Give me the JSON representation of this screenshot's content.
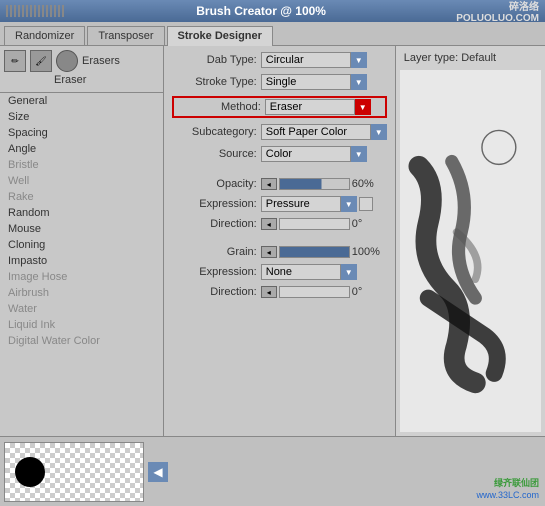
{
  "titleBar": {
    "grip": "grip",
    "title": "Brush Creator @ 100%",
    "logo": "碎洛络\nPOLUOLUO.COM"
  },
  "tabs": [
    {
      "id": "randomizer",
      "label": "Randomizer",
      "active": false
    },
    {
      "id": "transposer",
      "label": "Transposer",
      "active": false
    },
    {
      "id": "stroke-designer",
      "label": "Stroke Designer",
      "active": true
    }
  ],
  "leftPanel": {
    "erasersLabel": "Erasers",
    "eraserLabel": "Eraser",
    "categories": [
      {
        "id": "general",
        "label": "General",
        "active": false
      },
      {
        "id": "size",
        "label": "Size",
        "active": false
      },
      {
        "id": "spacing",
        "label": "Spacing",
        "active": false
      },
      {
        "id": "angle",
        "label": "Angle",
        "active": false
      },
      {
        "id": "bristle",
        "label": "Bristle",
        "active": false,
        "disabled": true
      },
      {
        "id": "well",
        "label": "Well",
        "active": false,
        "disabled": true
      },
      {
        "id": "rake",
        "label": "Rake",
        "active": false,
        "disabled": true
      },
      {
        "id": "random",
        "label": "Random",
        "active": false
      },
      {
        "id": "mouse",
        "label": "Mouse",
        "active": false
      },
      {
        "id": "cloning",
        "label": "Cloning",
        "active": false
      },
      {
        "id": "impasto",
        "label": "Impasto",
        "active": false
      },
      {
        "id": "image-hose",
        "label": "Image Hose",
        "active": false,
        "disabled": true
      },
      {
        "id": "airbrush",
        "label": "Airbrush",
        "active": false,
        "disabled": true
      },
      {
        "id": "water",
        "label": "Water",
        "active": false,
        "disabled": true
      },
      {
        "id": "liquid-ink",
        "label": "Liquid Ink",
        "active": false,
        "disabled": true
      },
      {
        "id": "digital-water",
        "label": "Digital Water Color",
        "active": false,
        "disabled": true
      }
    ]
  },
  "settings": {
    "dabTypeLabel": "Dab Type:",
    "dabTypeValue": "Circular",
    "strokeTypeLabel": "Stroke Type:",
    "strokeTypeValue": "Single",
    "methodLabel": "Method:",
    "methodValue": "Eraser",
    "subcategoryLabel": "Subcategory:",
    "subcategoryValue": "Soft Paper Color",
    "sourceLabel": "Source:",
    "sourceValue": "Color",
    "opacityLabel": "Opacity:",
    "opacityValue": "60%",
    "opacityPercent": 60,
    "expressionLabel": "Expression:",
    "expressionValue": "Pressure",
    "directionLabel": "Direction:",
    "directionValue": "0°",
    "grainLabel": "Grain:",
    "grainValue": "100%",
    "grainPercent": 100,
    "expression2Label": "Expression:",
    "expression2Value": "None",
    "direction2Label": "Direction:",
    "direction2Value": "0°"
  },
  "preview": {
    "layerTypeLabel": "Layer type: Default"
  },
  "bottomWatermark": {
    "line1": "绿齐联仙团",
    "line2": "www.33LC.com"
  }
}
